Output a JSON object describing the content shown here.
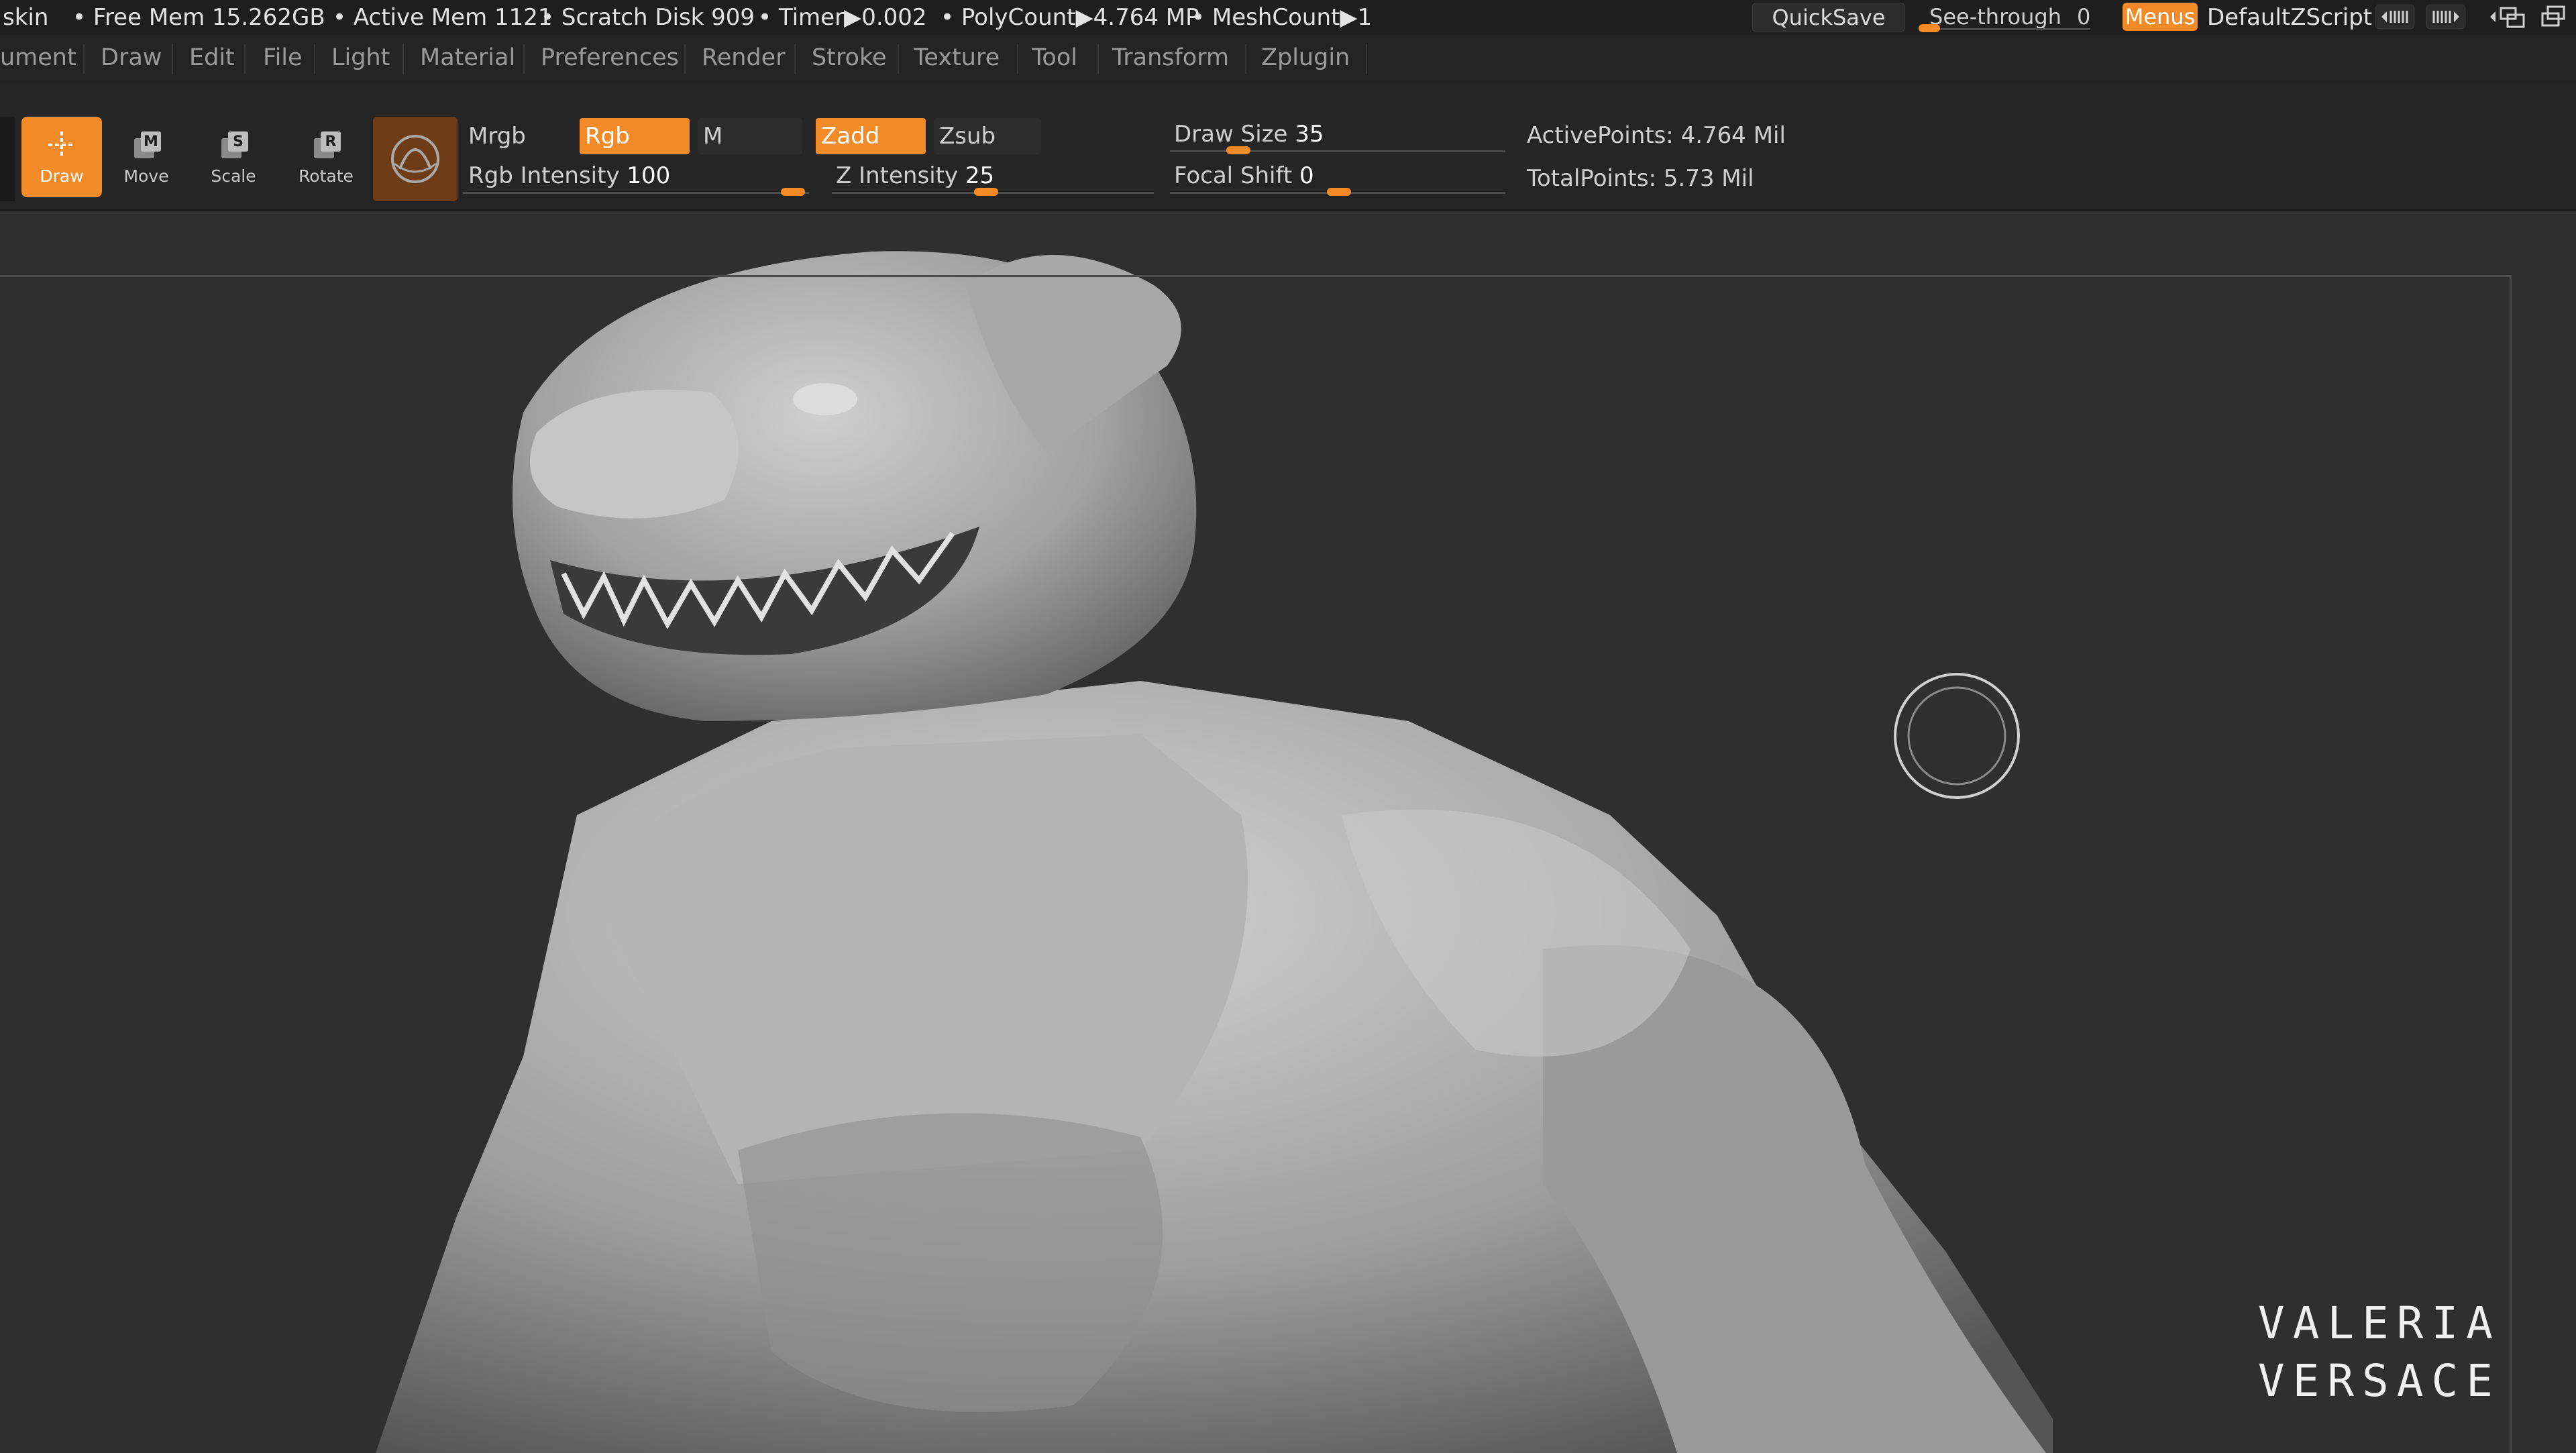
{
  "status_bar": {
    "left_fragment": "skin",
    "free_mem": "• Free Mem 15.262GB",
    "active_mem": "• Active Mem 1121",
    "scratch_disk": "• Scratch Disk 909",
    "timer": "• Timer▶0.002",
    "polycount": "• PolyCount▶4.764 MP",
    "meshcount": "• MeshCount▶1",
    "quicksave_label": "QuickSave",
    "see_through_label": "See-through",
    "see_through_value": "0",
    "menus_label": "Menus",
    "script_label": "DefaultZScript"
  },
  "menu_bar": {
    "items": [
      "ument",
      "Draw",
      "Edit",
      "File",
      "Light",
      "Material",
      "Preferences",
      "Render",
      "Stroke",
      "Texture",
      "Tool",
      "Transform",
      "Zplugin"
    ]
  },
  "shelf": {
    "tools": [
      {
        "label": "Draw",
        "icon": "draw-icon",
        "active": true
      },
      {
        "label": "Move",
        "icon": "move-icon",
        "active": false
      },
      {
        "label": "Scale",
        "icon": "scale-icon",
        "active": false
      },
      {
        "label": "Rotate",
        "icon": "rotate-icon",
        "active": false
      }
    ],
    "mrgb": "Mrgb",
    "rgb": "Rgb",
    "m": "M",
    "zadd": "Zadd",
    "zsub": "Zsub",
    "rgb_intensity_label": "Rgb Intensity",
    "rgb_intensity_value": "100",
    "z_intensity_label": "Z Intensity",
    "z_intensity_value": "25",
    "draw_size_label": "Draw Size",
    "draw_size_value": "35",
    "focal_shift_label": "Focal Shift",
    "focal_shift_value": "0",
    "active_points": "ActivePoints: 4.764 Mil",
    "total_points": "TotalPoints: 5.73 Mil"
  },
  "watermark": {
    "line1": "VALERIA",
    "line2": "VERSACE"
  },
  "colors": {
    "accent": "#f28a28",
    "bg": "#2e2e2e",
    "material_swatch": "#6e3d18"
  }
}
